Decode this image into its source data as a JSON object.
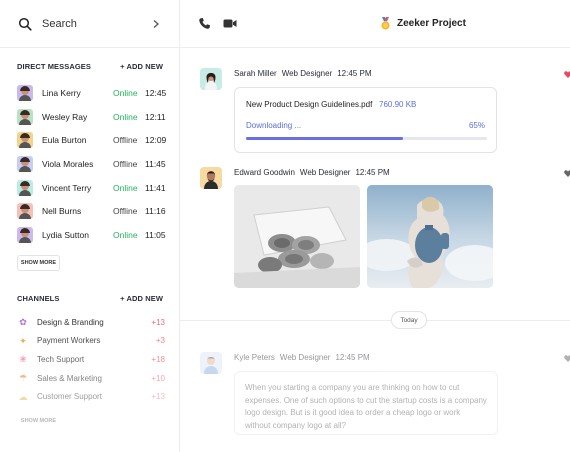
{
  "search": {
    "label": "Search"
  },
  "direct_messages": {
    "heading": "DIRECT MESSAGES",
    "add_new": "+ ADD NEW",
    "items": [
      {
        "name": "Lina Kerry",
        "status": "Online",
        "time": "12:45",
        "bg": "#c9b9ef"
      },
      {
        "name": "Wesley Ray",
        "status": "Online",
        "time": "12:11",
        "bg": "#b7e3c4"
      },
      {
        "name": "Eula Burton",
        "status": "Offline",
        "time": "12:09",
        "bg": "#f3d38b"
      },
      {
        "name": "Viola Morales",
        "status": "Offline",
        "time": "11:45",
        "bg": "#c7cdf4"
      },
      {
        "name": "Vincent Terry",
        "status": "Online",
        "time": "11:41",
        "bg": "#b9ece2"
      },
      {
        "name": "Nell Burns",
        "status": "Offline",
        "time": "11:16",
        "bg": "#f4c1b8"
      },
      {
        "name": "Lydia Sutton",
        "status": "Online",
        "time": "11:05",
        "bg": "#cbb9ef"
      }
    ],
    "show_more": "SHOW MORE"
  },
  "channels": {
    "heading": "CHANNELS",
    "add_new": "+ ADD NEW",
    "items": [
      {
        "name": "Design & Branding",
        "count": "+13",
        "icon": "unicorn-icon",
        "glyph": "✿",
        "color": "#b46fd8"
      },
      {
        "name": "Payment Workers",
        "count": "+3",
        "icon": "money-icon",
        "glyph": "✦",
        "color": "#e6a23c"
      },
      {
        "name": "Tech Support",
        "count": "+18",
        "icon": "flower-icon",
        "glyph": "❀",
        "color": "#ef7fa2"
      },
      {
        "name": "Sales & Marketing",
        "count": "+10",
        "icon": "rainbow-icon",
        "glyph": "☂",
        "color": "#f0873a"
      },
      {
        "name": "Customer Support",
        "count": "+13",
        "icon": "cloud-icon",
        "glyph": "☁",
        "color": "#e8b04a"
      }
    ],
    "show_more": "SHOW MORE"
  },
  "header": {
    "project": "Zeeker Project"
  },
  "messages": [
    {
      "sender": "Sarah Miller",
      "role": "Web Designer",
      "time": "12:45 PM"
    },
    {
      "sender": "Edward Goodwin",
      "role": "Web Designer",
      "time": "12:45 PM"
    },
    {
      "sender": "Kyle Peters",
      "role": "Web Designer",
      "time": "12:45 PM"
    }
  ],
  "file": {
    "name": "New Product Design Guidelines.pdf",
    "size": "760.90 KB",
    "status": "Downloading ...",
    "progress_label": "65%",
    "progress": 0.65
  },
  "divider": {
    "label": "Today"
  },
  "draft_text": "When you starting a company you are thinking on how to cut expenses. One of such options to cut the startup costs is a company logo design. But is it good idea to order a cheap logo or work without company logo at all?",
  "colors": {
    "accent": "#5b6ee1",
    "online": "#22b25d",
    "badge": "#f06b73"
  }
}
